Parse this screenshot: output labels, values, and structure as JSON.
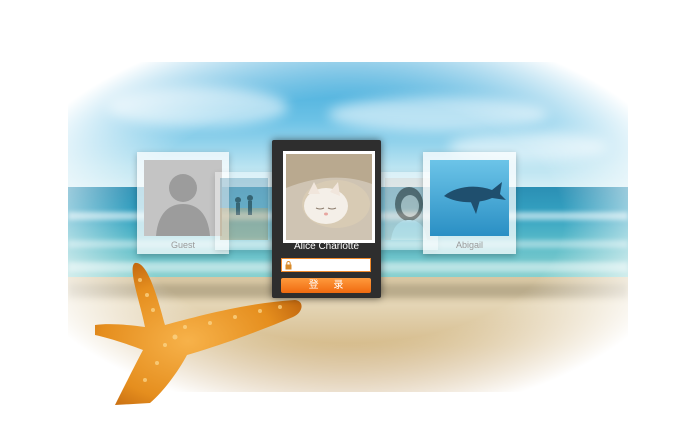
{
  "users": [
    {
      "name": "Guest",
      "avatar": "person-silhouette"
    },
    {
      "name": "",
      "avatar": "beach-couple-photo"
    },
    {
      "name": "Alice Charlotte",
      "avatar": "sleeping-cat-photo",
      "active": true
    },
    {
      "name": "",
      "avatar": "woman-portrait-photo"
    },
    {
      "name": "Abigail",
      "avatar": "whale-photo"
    }
  ],
  "login": {
    "password_placeholder": "",
    "button_label": "登 录",
    "lock_icon": "lock-icon"
  },
  "colors": {
    "accent": "#f47b1f",
    "panel": "#2e2e2e"
  }
}
